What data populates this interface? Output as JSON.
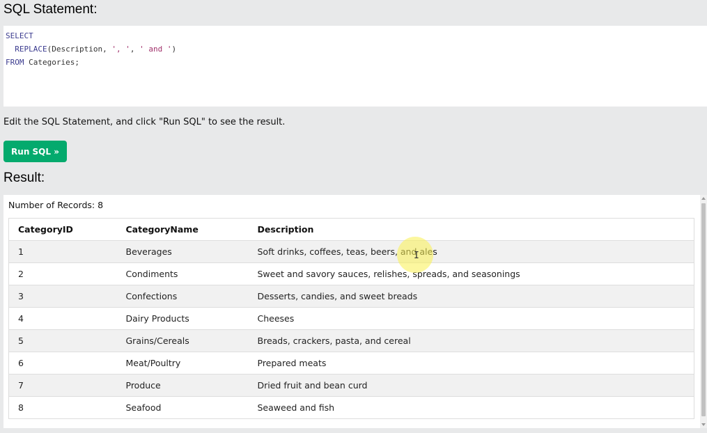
{
  "sql_section": {
    "heading": "SQL Statement:",
    "code_lines": [
      {
        "parts": [
          {
            "t": "SELECT",
            "c": "kw"
          }
        ]
      },
      {
        "parts": [
          {
            "t": "  ",
            "c": ""
          },
          {
            "t": "REPLACE",
            "c": "fn"
          },
          {
            "t": "(Description, ",
            "c": ""
          },
          {
            "t": "', '",
            "c": "str"
          },
          {
            "t": ", ",
            "c": ""
          },
          {
            "t": "' and '",
            "c": "str"
          },
          {
            "t": ")",
            "c": ""
          }
        ]
      },
      {
        "parts": [
          {
            "t": "FROM",
            "c": "kw"
          },
          {
            "t": " Categories;",
            "c": ""
          }
        ]
      }
    ]
  },
  "instructions": "Edit the SQL Statement, and click \"Run SQL\" to see the result.",
  "run_button_label": "Run SQL »",
  "result_section": {
    "heading": "Result:",
    "records_text": "Number of Records: 8",
    "columns": [
      "CategoryID",
      "CategoryName",
      "Description"
    ],
    "rows": [
      [
        "1",
        "Beverages",
        "Soft drinks, coffees, teas, beers, and ales"
      ],
      [
        "2",
        "Condiments",
        "Sweet and savory sauces, relishes, spreads, and seasonings"
      ],
      [
        "3",
        "Confections",
        "Desserts, candies, and sweet breads"
      ],
      [
        "4",
        "Dairy Products",
        "Cheeses"
      ],
      [
        "5",
        "Grains/Cereals",
        "Breads, crackers, pasta, and cereal"
      ],
      [
        "6",
        "Meat/Poultry",
        "Prepared meats"
      ],
      [
        "7",
        "Produce",
        "Dried fruit and bean curd"
      ],
      [
        "8",
        "Seafood",
        "Seaweed and fish"
      ]
    ]
  },
  "colors": {
    "button_bg": "#04aa6d",
    "page_bg": "#e8e9ea",
    "keyword": "#3b3b8f",
    "string": "#a0306a"
  },
  "icons": {
    "text_cursor": "I-beam"
  }
}
